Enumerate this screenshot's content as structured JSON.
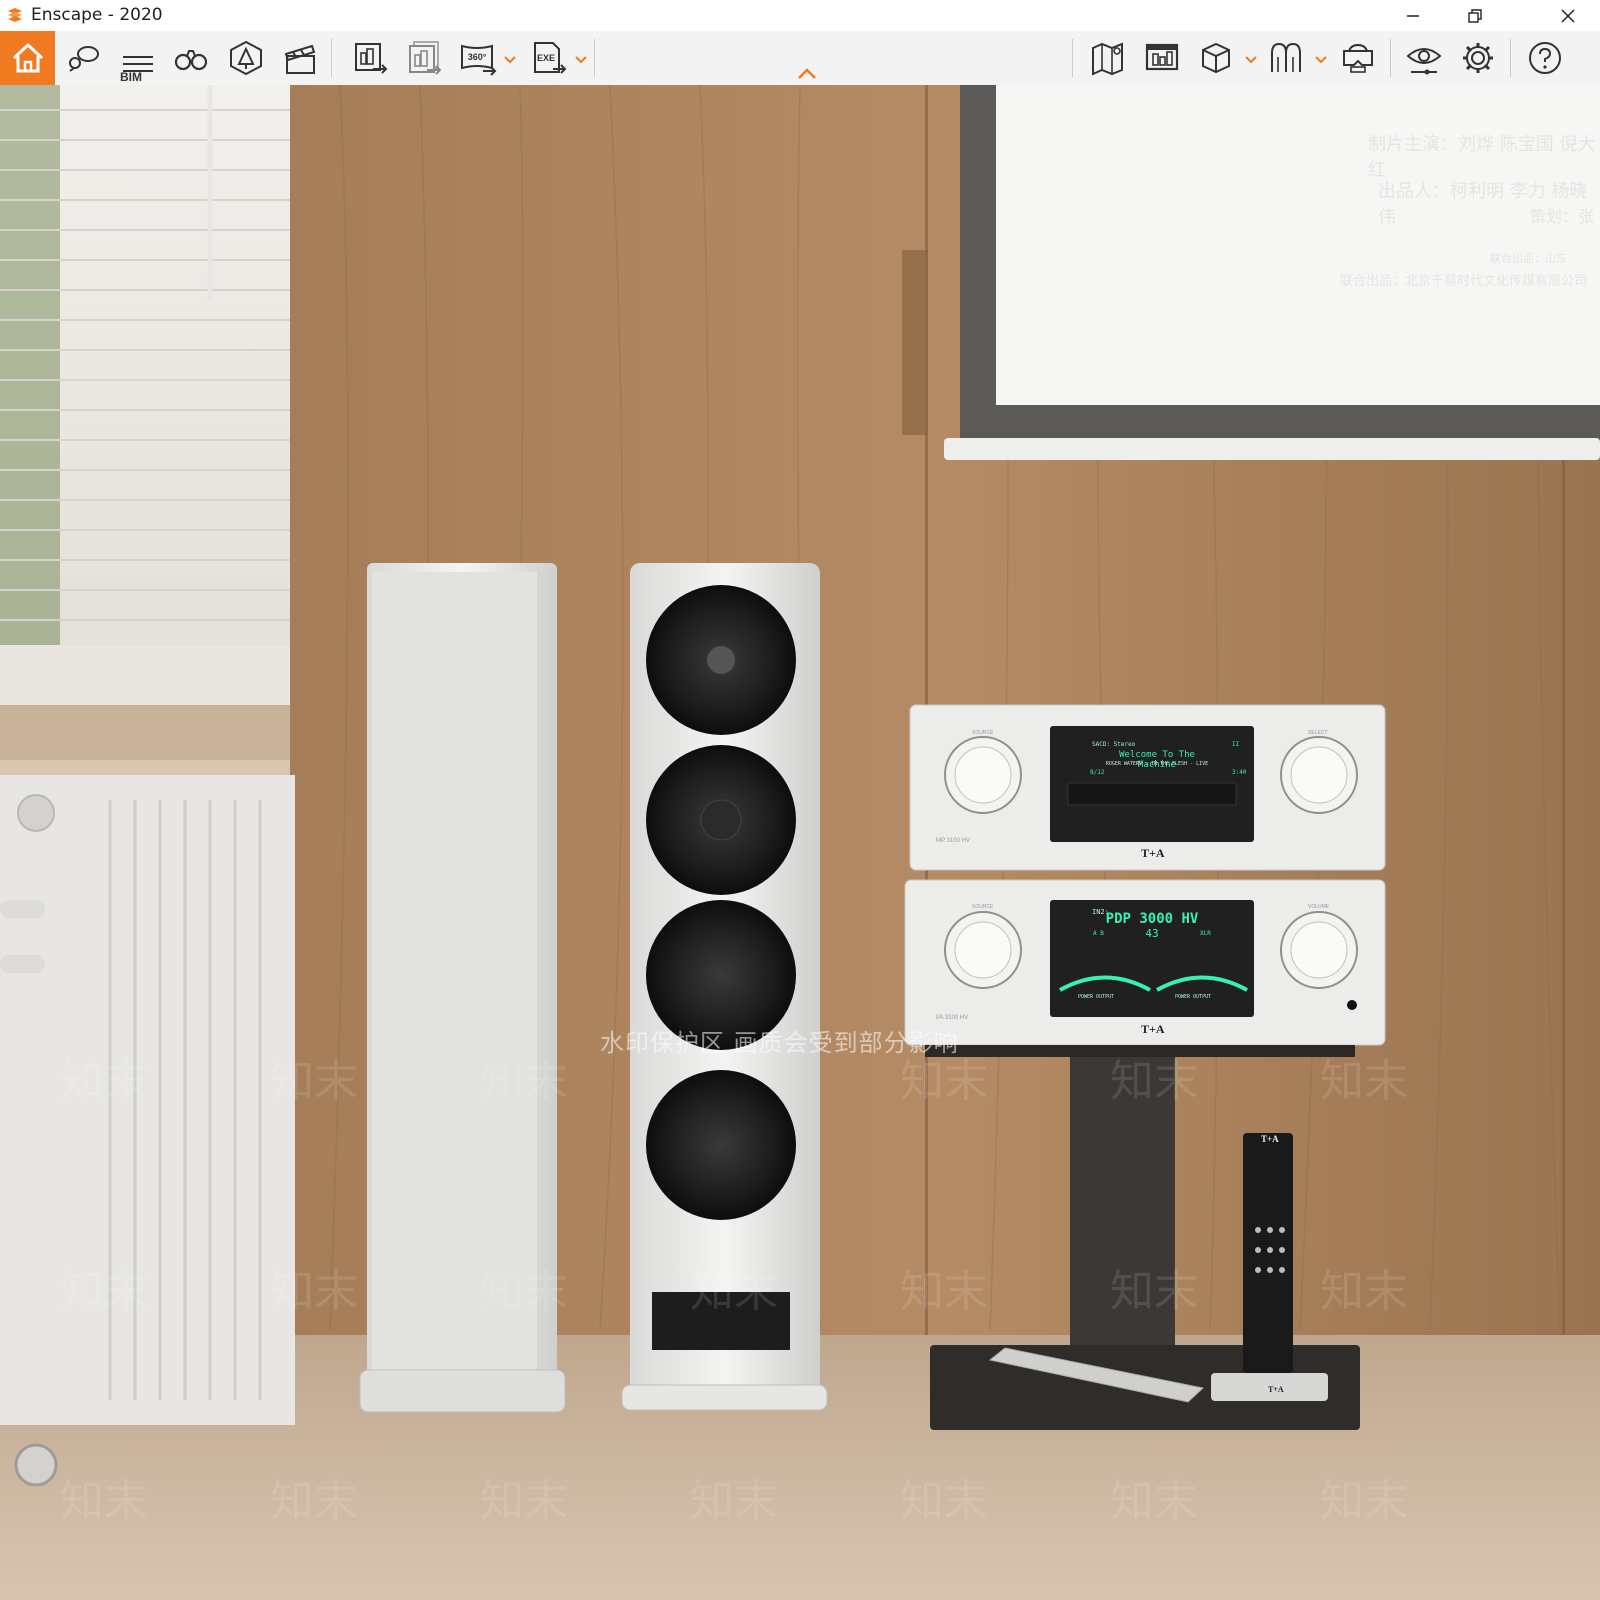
{
  "window": {
    "title": "Enscape - 2020",
    "minimize_icon": "minimize-icon",
    "restore_icon": "restore-icon",
    "close_icon": "close-icon"
  },
  "toolbar": {
    "accent_color": "#f07a1f",
    "bim_label": "BIM",
    "left_tools": [
      {
        "icon": "home-icon",
        "active": true
      },
      {
        "icon": "views-icon"
      },
      {
        "icon": "bim-icon"
      },
      {
        "icon": "binoculars-icon"
      },
      {
        "icon": "asset-library-icon"
      },
      {
        "icon": "video-editor-icon"
      },
      {
        "icon": "screenshot-export-icon"
      },
      {
        "icon": "batch-export-icon"
      },
      {
        "icon": "panorama-360-icon"
      },
      {
        "icon": "exe-export-icon"
      }
    ],
    "right_tools": [
      {
        "icon": "map-icon"
      },
      {
        "icon": "upload-icon"
      },
      {
        "icon": "cube-icon"
      },
      {
        "icon": "material-icon"
      },
      {
        "icon": "vr-headset-icon"
      },
      {
        "icon": "visual-settings-icon"
      },
      {
        "icon": "settings-icon"
      },
      {
        "icon": "help-icon"
      }
    ],
    "panel_toggle_icon": "chevron-up-icon"
  },
  "viewport": {
    "screen_lines": [
      "制片主演：刘烨 陈宝国 倪大红",
      "出品人：柯利明 李力 杨晓伟",
      "策划：张",
      "联合出品：山东",
      "联合出品：北京千易时代文化传媒有限公司"
    ],
    "cd_display": {
      "line1": "SACD: Stereo",
      "line2": "Welcome To The Machine",
      "line3": "ROGER WATERS - IN THE FLESH - LIVE",
      "line4": "8/12",
      "line5": "3:40",
      "line6": "II"
    },
    "amp_display": {
      "line1": "PDP 3000 HV",
      "line2": "43",
      "left": "A B",
      "right": "XLR",
      "top_left": "IN2:"
    },
    "brand_label": "T+A",
    "cd_model": "MP 3100 HV",
    "amp_model": "PA 3100 HV",
    "knob_labels": [
      "SOURCE",
      "SELECT",
      "SOURCE",
      "VOLUME"
    ],
    "meter_labels": [
      "POWER OUTPUT",
      "POWER OUTPUT"
    ],
    "remote_brand": "T+A",
    "watermark_strip": "水印保护区 画质会受到部分影响",
    "watermark_mark": "知末"
  }
}
